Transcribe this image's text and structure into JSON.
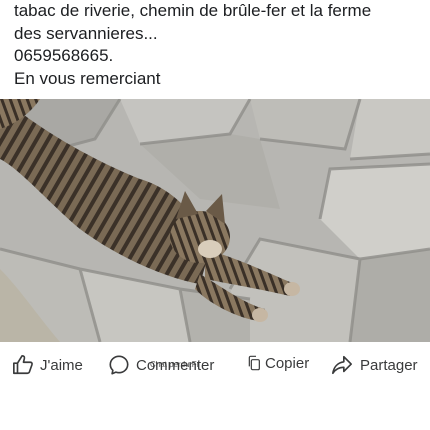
{
  "post": {
    "lines": [
      "tabac de riverie, chemin de brûle-fer et la ferme",
      "des servannieres...",
      "0659568665.",
      "En vous remerciant"
    ]
  },
  "photo": {
    "subject_icon": "cat-photo"
  },
  "actions": {
    "like_label": "J'aime",
    "comment_label": "Commenter",
    "overlay_label": "Chat perdu.Fr",
    "copy_label": "Copier",
    "share_label": "Partager"
  },
  "colors": {
    "text": "#1c1e21",
    "action_text": "#3a3b3c",
    "background": "#ffffff"
  }
}
